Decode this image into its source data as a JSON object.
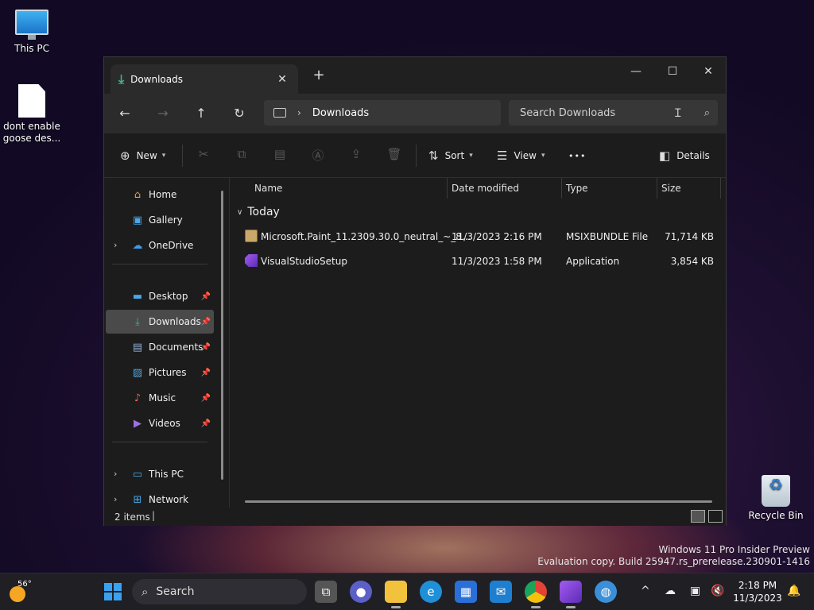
{
  "desktop": {
    "icons": [
      {
        "label": "This PC"
      },
      {
        "label": "dont enable goose des..."
      },
      {
        "label": "Recycle Bin"
      }
    ]
  },
  "window": {
    "tab": {
      "label": "Downloads",
      "close": "✕"
    },
    "new_tab": "+",
    "controls": {
      "minimize": "—",
      "maximize": "☐",
      "close": "✕"
    },
    "nav": {
      "back": "←",
      "forward": "→",
      "up": "↑",
      "refresh": "↻"
    },
    "address": {
      "chevron": "›",
      "crumb": "Downloads"
    },
    "search": {
      "placeholder": "Search Downloads"
    },
    "toolbar": {
      "new_label": "New",
      "sort_label": "Sort",
      "view_label": "View",
      "more": "•••",
      "details_label": "Details"
    },
    "sidebar": {
      "items": [
        {
          "label": "Home"
        },
        {
          "label": "Gallery"
        },
        {
          "label": "OneDrive"
        },
        {
          "label": "Desktop"
        },
        {
          "label": "Downloads"
        },
        {
          "label": "Documents"
        },
        {
          "label": "Pictures"
        },
        {
          "label": "Music"
        },
        {
          "label": "Videos"
        },
        {
          "label": "This PC"
        },
        {
          "label": "Network"
        }
      ]
    },
    "columns": {
      "name": "Name",
      "date": "Date modified",
      "type": "Type",
      "size": "Size"
    },
    "group": "Today",
    "files": [
      {
        "name": "Microsoft.Paint_11.2309.30.0_neutral_~_8...",
        "date": "11/3/2023 2:16 PM",
        "type": "MSIXBUNDLE File",
        "size": "71,714 KB"
      },
      {
        "name": "VisualStudioSetup",
        "date": "11/3/2023 1:58 PM",
        "type": "Application",
        "size": "3,854 KB"
      }
    ],
    "status": {
      "count": "2 items",
      "caret": "|"
    }
  },
  "watermark": {
    "line1": "Windows 11 Pro Insider Preview",
    "line2": "Evaluation copy. Build 25947.rs_prerelease.230901-1416"
  },
  "taskbar": {
    "weather_temp": "56°",
    "search_label": "Search",
    "tray_chevron": "^",
    "clock_time": "2:18 PM",
    "clock_date": "11/3/2023"
  },
  "colors": {
    "accent": "#3fb68b",
    "selection": "#4a4a4a",
    "window_bg": "#1c1c1c"
  }
}
